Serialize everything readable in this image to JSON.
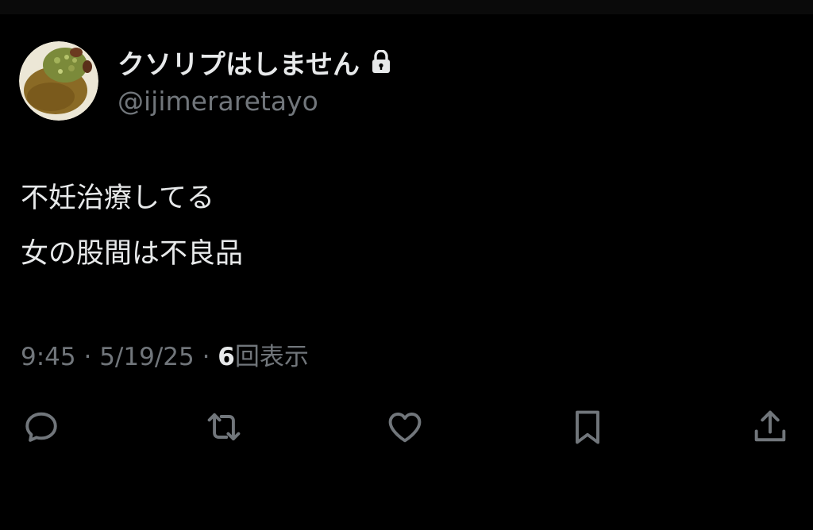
{
  "user": {
    "display_name": "クソリプはしません",
    "handle": "@ijimeraretayo",
    "protected": true
  },
  "tweet": {
    "lines": [
      "不妊治療してる",
      "女の股間は不良品"
    ],
    "time": "9:45",
    "date": "5/19/25",
    "views_count": "6",
    "views_label": "回表示",
    "separator": "·"
  },
  "actions": [
    "reply-icon",
    "retweet-icon",
    "like-icon",
    "bookmark-icon",
    "share-icon"
  ],
  "colors": {
    "background": "#000000",
    "primary_text": "#e7e9ea",
    "secondary_text": "#71767b"
  }
}
